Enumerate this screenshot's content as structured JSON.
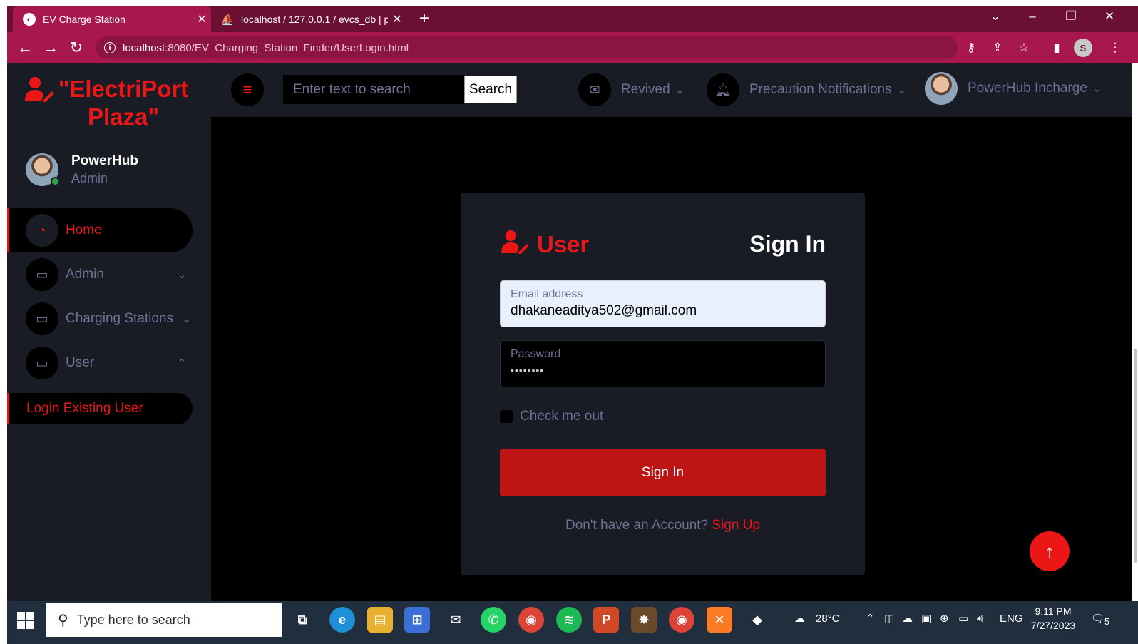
{
  "browser": {
    "tabs": [
      {
        "title": "EV Charge Station",
        "close": "✕"
      },
      {
        "title": "localhost / 127.0.0.1 / evcs_db | p",
        "close": "✕"
      }
    ],
    "new_tab": "+",
    "url_host": "localhost",
    "url_path": ":8080/EV_Charging_Station_Finder/UserLogin.html",
    "profile_initial": "S"
  },
  "sidebar": {
    "brand_line1": "\"ElectriPort",
    "brand_line2": "Plaza\"",
    "profile_name": "PowerHub",
    "profile_role": "Admin",
    "items": [
      {
        "label": "Home"
      },
      {
        "label": "Admin"
      },
      {
        "label": "Charging Stations"
      },
      {
        "label": "User"
      }
    ],
    "sub_item": "Login Existing User"
  },
  "topbar": {
    "search_placeholder": "Enter text to search",
    "search_button": "Search",
    "messages_label": "Revived",
    "notifications_label": "Precaution Notifications",
    "user_label": "PowerHub Incharge"
  },
  "login": {
    "brand": "User",
    "title": "Sign In",
    "email_label": "Email address",
    "email_value": "dhakaneaditya502@gmail.com",
    "password_label": "Password",
    "password_value": "••••••••",
    "check_label": "Check me out",
    "submit": "Sign In",
    "signup_prompt": "Don't have an Account?",
    "signup_link": "Sign Up"
  },
  "taskbar": {
    "search_placeholder": "Type here to search",
    "weather": "28°C",
    "language": "ENG",
    "time": "9:11 PM",
    "date": "7/27/2023",
    "notification_count": "5"
  },
  "colors": {
    "accent": "#eb1616",
    "panel": "#191c24",
    "muted": "#6c7293",
    "chrome": "#a8184f"
  }
}
